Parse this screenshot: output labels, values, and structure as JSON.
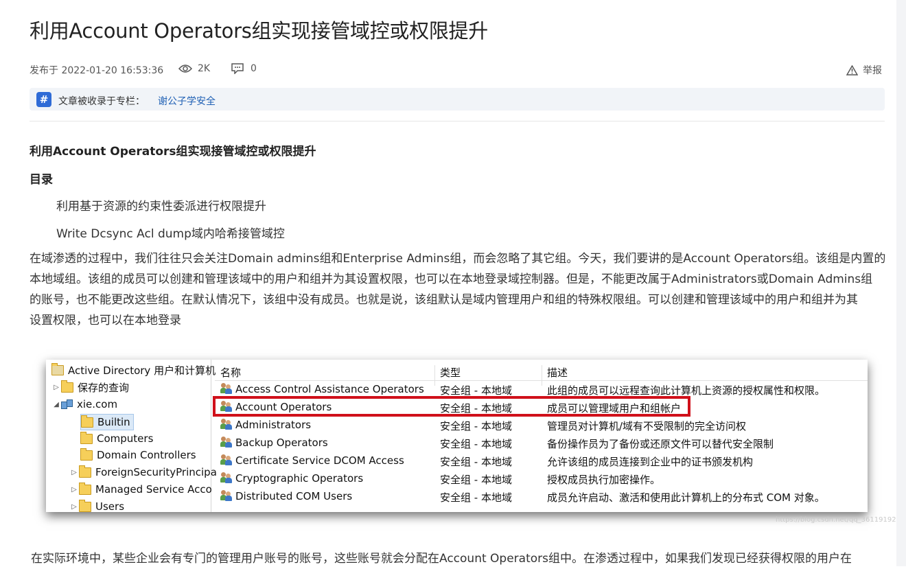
{
  "article": {
    "title": "利用Account Operators组实现接管域控或权限提升",
    "meta": {
      "published": "发布于 2022-01-20 16:53:36",
      "views": "2K",
      "comments": "0",
      "report": "举报"
    },
    "column": {
      "icon_text": "#",
      "label": "文章被收录于专栏：",
      "link": "谢公子学安全"
    },
    "heading": "利用Account Operators组实现接管域控或权限提升",
    "toc_title": "目录",
    "toc": [
      "利用基于资源的约束性委派进行权限提升",
      "Write Dcsync Acl dump域内哈希接管域控"
    ],
    "paragraph_lines": [
      "  在域渗透的过程中，我们往往只会关注Domain admins组和Enterprise Admins组，而会忽略了其它组。今天，我们要讲的是Account Operators组。该组是内置的",
      "本地域组。该组的成员可以创建和管理该域中的用户和组并为其设置权限，也可以在本地登录域控制器。但是，不能更改属于Administrators或Domain Admins组",
      "的账号，也不能更改这些组。在默认情况下，该组中没有成员。也就是说，该组默认是域内管理用户和组的特殊权限组。可以创建和管理该域中的用户和组并为其",
      "设置权限，也可以在本地登录"
    ],
    "bottom_line": "  在实际环境中，某些企业会有专门的管理用户账号的账号，这些账号就会分配在Account Operators组中。在渗透过程中，如果我们发现已经获得权限的用户在"
  },
  "figure": {
    "tree": {
      "root": "Active Directory 用户和计算机",
      "saved_queries": "保存的查询",
      "domain": "xie.com",
      "children": [
        "Builtin",
        "Computers",
        "Domain Controllers",
        "ForeignSecurityPrincipa",
        "Managed Service Acco",
        "Users"
      ]
    },
    "columns": [
      "名称",
      "类型",
      "描述"
    ],
    "rows": [
      {
        "name": "Access Control Assistance Operators",
        "type": "安全组 - 本地域",
        "desc": "此组的成员可以远程查询此计算机上资源的授权属性和权限。"
      },
      {
        "name": "Account Operators",
        "type": "安全组 - 本地域",
        "desc": "成员可以管理域用户和组帐户"
      },
      {
        "name": "Administrators",
        "type": "安全组 - 本地域",
        "desc": "管理员对计算机/域有不受限制的完全访问权"
      },
      {
        "name": "Backup Operators",
        "type": "安全组 - 本地域",
        "desc": "备份操作员为了备份或还原文件可以替代安全限制"
      },
      {
        "name": "Certificate Service DCOM Access",
        "type": "安全组 - 本地域",
        "desc": "允许该组的成员连接到企业中的证书颁发机构"
      },
      {
        "name": "Cryptographic Operators",
        "type": "安全组 - 本地域",
        "desc": "授权成员执行加密操作。"
      },
      {
        "name": "Distributed COM Users",
        "type": "安全组 - 本地域",
        "desc": "成员允许启动、激活和使用此计算机上的分布式 COM 对象。"
      }
    ],
    "watermark": "https://blog.csdn.net/qq_36119192"
  },
  "colors": {
    "link": "#1e5fb4",
    "highlight": "#d0101a",
    "column_icon": "#2f6bd6"
  }
}
